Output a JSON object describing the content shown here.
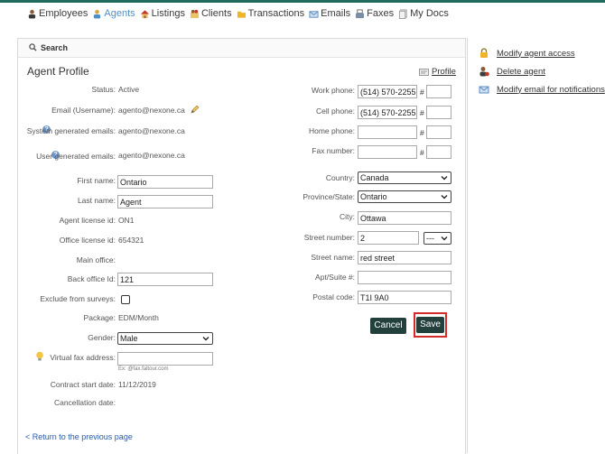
{
  "nav": {
    "items": [
      {
        "label": "Employees",
        "icon": "employees-icon"
      },
      {
        "label": "Agents",
        "icon": "agents-icon"
      },
      {
        "label": "Listings",
        "icon": "house-icon"
      },
      {
        "label": "Clients",
        "icon": "clients-icon"
      },
      {
        "label": "Transactions",
        "icon": "folder-icon"
      },
      {
        "label": "Emails",
        "icon": "envelope-icon"
      },
      {
        "label": "Faxes",
        "icon": "fax-icon"
      },
      {
        "label": "My Docs",
        "icon": "documents-icon"
      }
    ]
  },
  "search": {
    "label": "Search"
  },
  "profile": {
    "title": "Agent Profile",
    "profile_link": "Profile",
    "status": {
      "label": "Status:",
      "value": "Active"
    },
    "email": {
      "label": "Email (Username):",
      "value": "agento@nexone.ca"
    },
    "system_emails": {
      "label": "System generated emails:",
      "value": "agento@nexone.ca"
    },
    "user_emails": {
      "label": "User generated emails:",
      "value": "agento@nexone.ca"
    },
    "first_name": {
      "label": "First name:",
      "value": "Ontario"
    },
    "last_name": {
      "label": "Last name:",
      "value": "Agent"
    },
    "agent_license": {
      "label": "Agent license id:",
      "value": "ON1"
    },
    "office_license": {
      "label": "Office license id:",
      "value": "654321"
    },
    "main_office": {
      "label": "Main office:",
      "value": ""
    },
    "back_office": {
      "label": "Back office Id:",
      "value": "121"
    },
    "exclude_surveys": {
      "label": "Exclude from surveys:",
      "checked": false
    },
    "package": {
      "label": "Package:",
      "value": "EDM/Month"
    },
    "gender": {
      "label": "Gender:",
      "value": "Male"
    },
    "virtual_fax": {
      "label": "Virtual fax address:",
      "value": "",
      "hint": "Ex: @fax.faltour.com"
    },
    "contract_start": {
      "label": "Contract start date:",
      "value": "11/12/2019"
    },
    "cancellation": {
      "label": "Cancellation date:",
      "value": ""
    },
    "work_phone": {
      "label": "Work phone:",
      "value": "(514) 570-2255",
      "ext": ""
    },
    "cell_phone": {
      "label": "Cell phone:",
      "value": "(514) 570-2255",
      "ext": ""
    },
    "home_phone": {
      "label": "Home phone:",
      "value": "",
      "ext": ""
    },
    "fax_number": {
      "label": "Fax number:",
      "value": "",
      "ext": ""
    },
    "hash": "#",
    "country": {
      "label": "Country:",
      "value": "Canada"
    },
    "province": {
      "label": "Province/State:",
      "value": "Ontario"
    },
    "city": {
      "label": "City:",
      "value": "Ottawa"
    },
    "street_number": {
      "label": "Street number:",
      "value": "2",
      "suffix": "---"
    },
    "street_name": {
      "label": "Street name:",
      "value": "red street"
    },
    "apt": {
      "label": "Apt/Suite #:",
      "value": ""
    },
    "postal": {
      "label": "Postal code:",
      "value": "T1I 9A0"
    }
  },
  "buttons": {
    "cancel": "Cancel",
    "save": "Save"
  },
  "back_link": "< Return to the previous page",
  "actions": [
    {
      "label": "Modify agent access",
      "icon": "lock-icon"
    },
    {
      "label": "Delete agent",
      "icon": "delete-user-icon"
    },
    {
      "label": "Modify email for notifications",
      "icon": "envelope-icon"
    }
  ],
  "colors": {
    "accent": "#1f6b5e",
    "button": "#23403d",
    "highlight": "#d42a2a",
    "link": "#2a5aa8"
  }
}
